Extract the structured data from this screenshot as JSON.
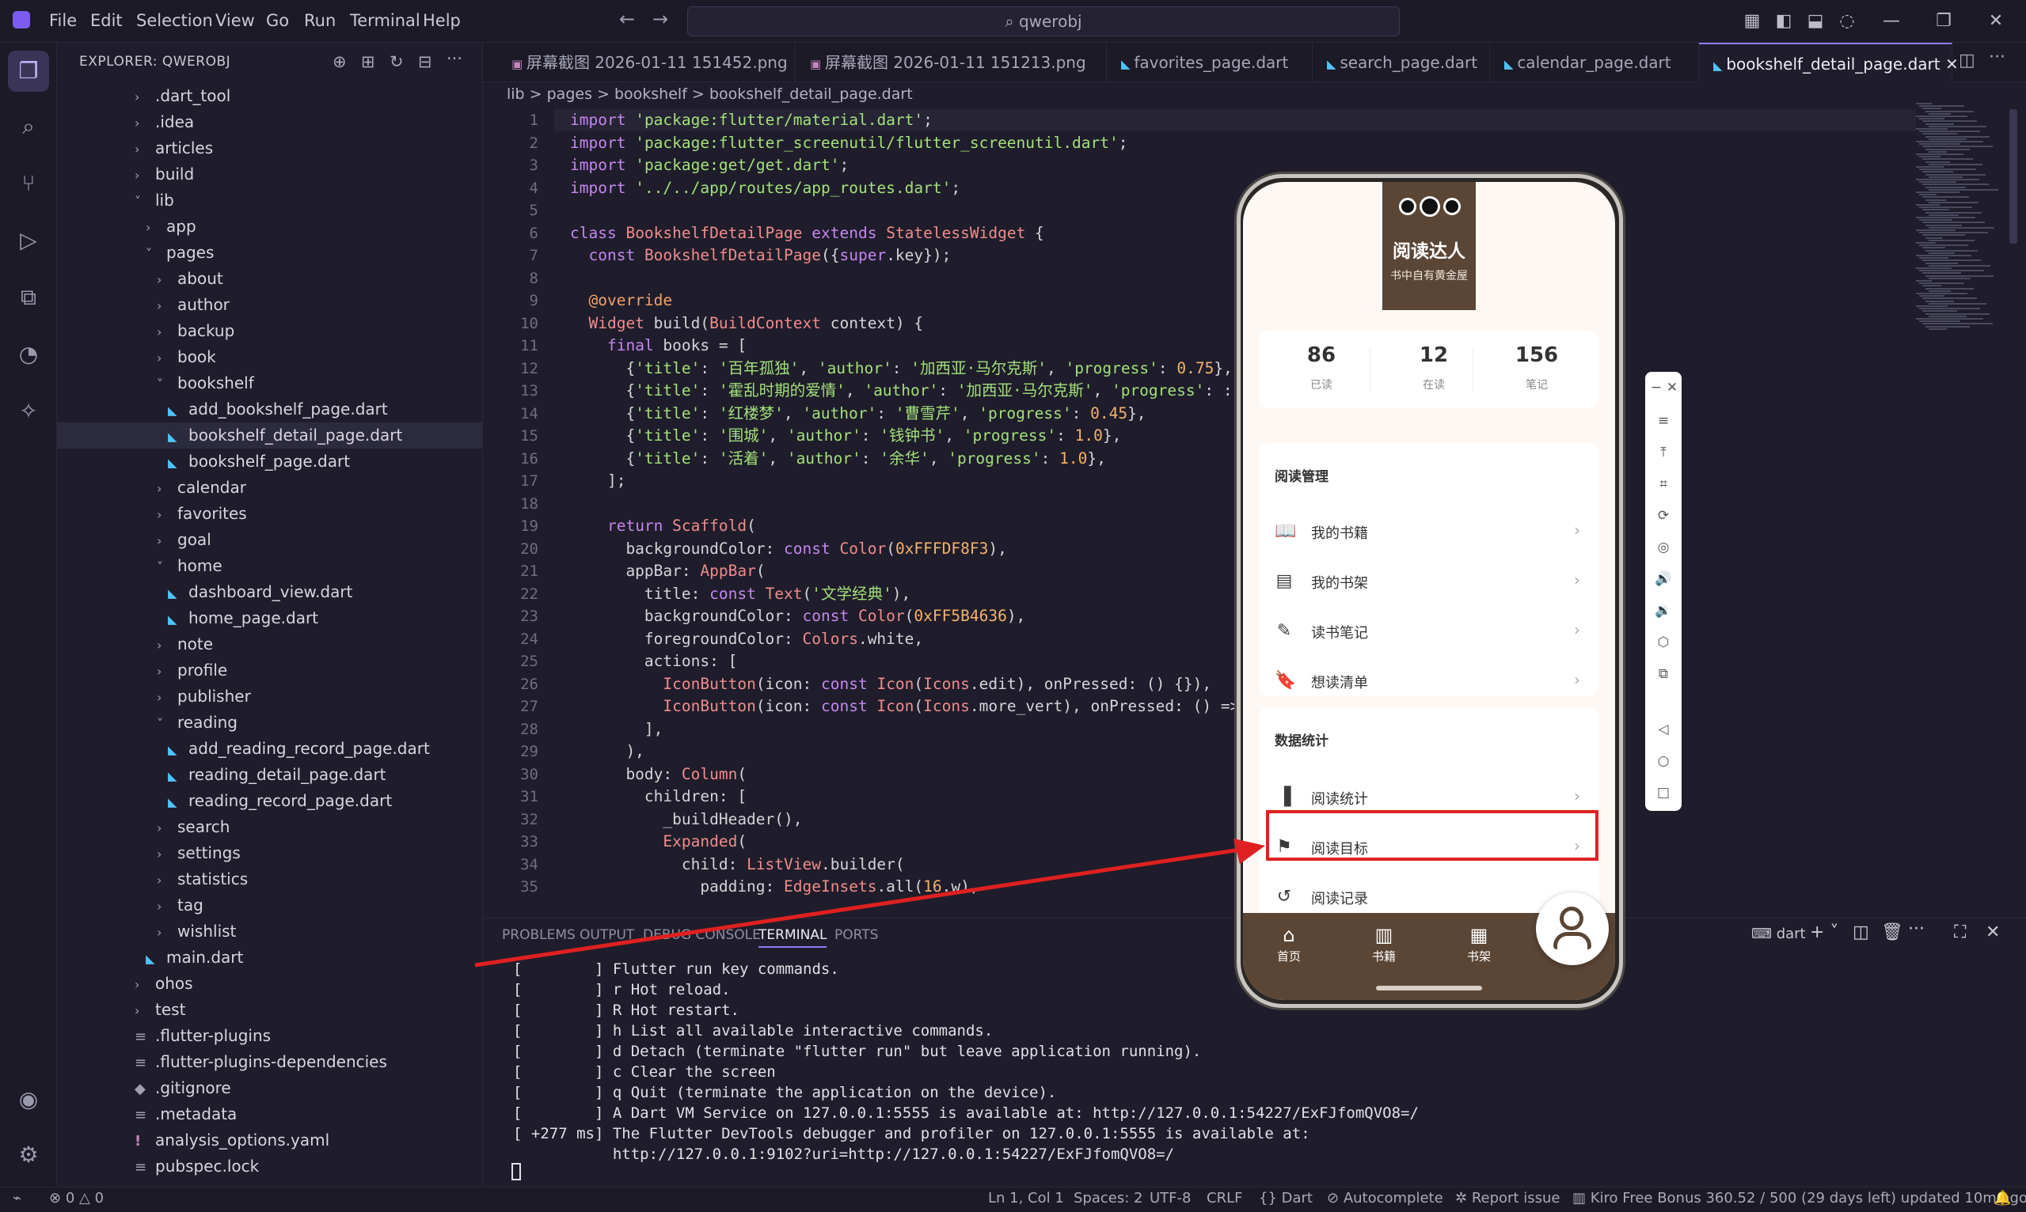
{
  "titlebar": {
    "menus": [
      "File",
      "Edit",
      "Selection",
      "View",
      "Go",
      "Run",
      "Terminal",
      "Help"
    ],
    "search": "qwerobj"
  },
  "sidebar": {
    "title": "EXPLORER: QWEROBJ",
    "tree": [
      {
        "label": ".dart_tool",
        "type": "folder",
        "depth": 0,
        "open": false
      },
      {
        "label": ".idea",
        "type": "folder",
        "depth": 0,
        "open": false
      },
      {
        "label": "articles",
        "type": "folder",
        "depth": 0,
        "open": false
      },
      {
        "label": "build",
        "type": "folder",
        "depth": 0,
        "open": false
      },
      {
        "label": "lib",
        "type": "folder",
        "depth": 0,
        "open": true
      },
      {
        "label": "app",
        "type": "folder",
        "depth": 1,
        "open": false
      },
      {
        "label": "pages",
        "type": "folder",
        "depth": 1,
        "open": true
      },
      {
        "label": "about",
        "type": "folder",
        "depth": 2,
        "open": false
      },
      {
        "label": "author",
        "type": "folder",
        "depth": 2,
        "open": false
      },
      {
        "label": "backup",
        "type": "folder",
        "depth": 2,
        "open": false
      },
      {
        "label": "book",
        "type": "folder",
        "depth": 2,
        "open": false
      },
      {
        "label": "bookshelf",
        "type": "folder",
        "depth": 2,
        "open": true
      },
      {
        "label": "add_bookshelf_page.dart",
        "type": "dart",
        "depth": 3
      },
      {
        "label": "bookshelf_detail_page.dart",
        "type": "dart",
        "depth": 3,
        "selected": true
      },
      {
        "label": "bookshelf_page.dart",
        "type": "dart",
        "depth": 3
      },
      {
        "label": "calendar",
        "type": "folder",
        "depth": 2,
        "open": false
      },
      {
        "label": "favorites",
        "type": "folder",
        "depth": 2,
        "open": false
      },
      {
        "label": "goal",
        "type": "folder",
        "depth": 2,
        "open": false
      },
      {
        "label": "home",
        "type": "folder",
        "depth": 2,
        "open": true
      },
      {
        "label": "dashboard_view.dart",
        "type": "dart",
        "depth": 3
      },
      {
        "label": "home_page.dart",
        "type": "dart",
        "depth": 3
      },
      {
        "label": "note",
        "type": "folder",
        "depth": 2,
        "open": false
      },
      {
        "label": "profile",
        "type": "folder",
        "depth": 2,
        "open": false
      },
      {
        "label": "publisher",
        "type": "folder",
        "depth": 2,
        "open": false
      },
      {
        "label": "reading",
        "type": "folder",
        "depth": 2,
        "open": true
      },
      {
        "label": "add_reading_record_page.dart",
        "type": "dart",
        "depth": 3
      },
      {
        "label": "reading_detail_page.dart",
        "type": "dart",
        "depth": 3
      },
      {
        "label": "reading_record_page.dart",
        "type": "dart",
        "depth": 3
      },
      {
        "label": "search",
        "type": "folder",
        "depth": 2,
        "open": false
      },
      {
        "label": "settings",
        "type": "folder",
        "depth": 2,
        "open": false
      },
      {
        "label": "statistics",
        "type": "folder",
        "depth": 2,
        "open": false
      },
      {
        "label": "tag",
        "type": "folder",
        "depth": 2,
        "open": false
      },
      {
        "label": "wishlist",
        "type": "folder",
        "depth": 2,
        "open": false
      },
      {
        "label": "main.dart",
        "type": "dart",
        "depth": 1
      },
      {
        "label": "ohos",
        "type": "folder",
        "depth": 0,
        "open": false
      },
      {
        "label": "test",
        "type": "folder",
        "depth": 0,
        "open": false
      },
      {
        "label": ".flutter-plugins",
        "type": "eq",
        "depth": 0
      },
      {
        "label": ".flutter-plugins-dependencies",
        "type": "eq",
        "depth": 0
      },
      {
        "label": ".gitignore",
        "type": "git",
        "depth": 0
      },
      {
        "label": ".metadata",
        "type": "eq",
        "depth": 0
      },
      {
        "label": "analysis_options.yaml",
        "type": "yaml",
        "depth": 0
      },
      {
        "label": "pubspec.lock",
        "type": "eq",
        "depth": 0
      }
    ]
  },
  "tabs": [
    {
      "label": "屏幕截图 2026-01-11 151452.png",
      "icon": "image"
    },
    {
      "label": "屏幕截图 2026-01-11 151213.png",
      "icon": "image"
    },
    {
      "label": "favorites_page.dart",
      "icon": "dart"
    },
    {
      "label": "search_page.dart",
      "icon": "dart"
    },
    {
      "label": "calendar_page.dart",
      "icon": "dart"
    },
    {
      "label": "bookshelf_detail_page.dart",
      "icon": "dart",
      "active": true
    }
  ],
  "breadcrumb": "lib > pages > bookshelf >  bookshelf_detail_page.dart",
  "code": [
    "import 'package:flutter/material.dart';",
    "import 'package:flutter_screenutil/flutter_screenutil.dart';",
    "import 'package:get/get.dart';",
    "import '../../app/routes/app_routes.dart';",
    "",
    "class BookshelfDetailPage extends StatelessWidget {",
    "  const BookshelfDetailPage({super.key});",
    "",
    "  @override",
    "  Widget build(BuildContext context) {",
    "    final books = [",
    "      {'title': '百年孤独', 'author': '加西亚·马尔克斯', 'progress': 0.75},",
    "      {'title': '霍乱时期的爱情', 'author': '加西亚·马尔克斯', 'progress': :",
    "      {'title': '红楼梦', 'author': '曹雪芹', 'progress': 0.45},",
    "      {'title': '围城', 'author': '钱钟书', 'progress': 1.0},",
    "      {'title': '活着', 'author': '余华', 'progress': 1.0},",
    "    ];",
    "",
    "    return Scaffold(",
    "      backgroundColor: const Color(0xFFFDF8F3),",
    "      appBar: AppBar(",
    "        title: const Text('文学经典'),",
    "        backgroundColor: const Color(0xFF5B4636),",
    "        foregroundColor: Colors.white,",
    "        actions: [",
    "          IconButton(icon: const Icon(Icons.edit), onPressed: () {}),",
    "          IconButton(icon: const Icon(Icons.more_vert), onPressed: () =>",
    "        ],",
    "      ),",
    "      body: Column(",
    "        children: [",
    "          _buildHeader(),",
    "          Expanded(",
    "            child: ListView.builder(",
    "              padding: EdgeInsets.all(16.w),"
  ],
  "panel": {
    "tabs": [
      "PROBLEMS",
      "OUTPUT",
      "DEBUG CONSOLE",
      "TERMINAL",
      "PORTS"
    ],
    "active_tab": "TERMINAL",
    "shell": "dart",
    "terminal_lines": [
      "[        ] Flutter run key commands.",
      "[        ] r Hot reload.",
      "[        ] R Hot restart.",
      "[        ] h List all available interactive commands.",
      "[        ] d Detach (terminate \"flutter run\" but leave application running).",
      "[        ] c Clear the screen",
      "[        ] q Quit (terminate the application on the device).",
      "[        ] A Dart VM Service on 127.0.0.1:5555 is available at: http://127.0.0.1:54227/ExFJfomQVO8=/",
      "[ +277 ms] The Flutter DevTools debugger and profiler on 127.0.0.1:5555 is available at:",
      "           http://127.0.0.1:9102?uri=http://127.0.0.1:54227/ExFJfomQVO8=/"
    ]
  },
  "statusbar": {
    "errors": "0",
    "warnings": "0",
    "position": "Ln 1, Col 1",
    "spaces": "Spaces: 2",
    "encoding": "UTF-8",
    "eol": "CRLF",
    "language": "Dart",
    "autocomplete": "Autocomplete",
    "report": "Report issue",
    "bonus": "Kiro Free Bonus 360.52 / 500 (29 days left) updated 10m ago"
  },
  "phone": {
    "profile_name": "阅读达人",
    "profile_subtitle": "书中自有黄金屋",
    "stats": [
      {
        "value": "86",
        "label": "已读"
      },
      {
        "value": "12",
        "label": "在读"
      },
      {
        "value": "156",
        "label": "笔记"
      }
    ],
    "section1_title": "阅读管理",
    "section1_items": [
      {
        "label": "我的书籍",
        "icon": "book-open-icon"
      },
      {
        "label": "我的书架",
        "icon": "library-icon"
      },
      {
        "label": "读书笔记",
        "icon": "edit-note-icon"
      },
      {
        "label": "想读清单",
        "icon": "bookmark-add-icon"
      }
    ],
    "section2_title": "数据统计",
    "section2_items": [
      {
        "label": "阅读统计",
        "icon": "bar-chart-icon"
      },
      {
        "label": "阅读目标",
        "icon": "flag-icon",
        "highlighted": true
      },
      {
        "label": "阅读记录",
        "icon": "history-icon"
      }
    ],
    "nav": [
      {
        "label": "首页",
        "icon": "home-icon"
      },
      {
        "label": "书籍",
        "icon": "book-icon"
      },
      {
        "label": "书架",
        "icon": "shelf-icon"
      }
    ],
    "colors": {
      "brown": "#5B4636",
      "background": "#FDF8F3",
      "highlight": "#E02020"
    }
  }
}
